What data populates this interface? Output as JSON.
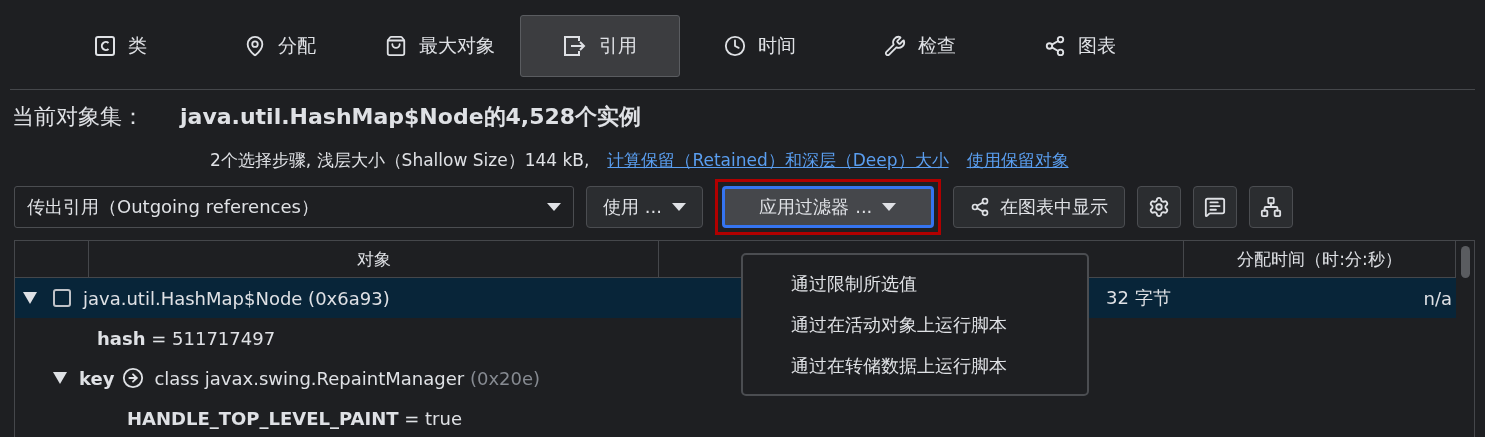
{
  "tabs": [
    {
      "label": "类",
      "selected": false
    },
    {
      "label": "分配",
      "selected": false
    },
    {
      "label": "最大对象",
      "selected": false
    },
    {
      "label": "引用",
      "selected": true
    },
    {
      "label": "时间",
      "selected": false
    },
    {
      "label": "检查",
      "selected": false
    },
    {
      "label": "图表",
      "selected": false
    }
  ],
  "header": {
    "label": "当前对象集：",
    "title": "java.util.HashMap$Node的4,528个实例",
    "summary": "2个选择步骤, 浅层大小（Shallow Size）144 kB,",
    "links": [
      "计算保留（Retained）和深层（Deep）大小",
      "使用保留对象"
    ]
  },
  "toolbar": {
    "view_select": "传出引用（Outgoing references）",
    "use_button": "使用 ...",
    "filter_button": "应用过滤器 ...",
    "graph_button": "在图表中显示",
    "highlighted": true
  },
  "filter_menu": {
    "open": true,
    "items": [
      "通过限制所选值",
      "通过在活动对象上运行脚本",
      "通过在转储数据上运行脚本"
    ]
  },
  "table": {
    "columns": [
      "对象",
      "分配时间（时:分:秒）"
    ],
    "rows": [
      {
        "kind": "object",
        "expanded": true,
        "checked": false,
        "selected": true,
        "text": "java.util.HashMap$Node (0x6a93)",
        "size": "32 字节",
        "time": "n/a",
        "children": [
          {
            "kind": "field",
            "name": "hash",
            "value": "= 511717497",
            "selected": false
          },
          {
            "kind": "ref",
            "expanded": true,
            "name": "key",
            "value": "class javax.swing.RepaintManager",
            "address": "(0x20e)",
            "selected": false,
            "children": [
              {
                "kind": "field",
                "name": "HANDLE_TOP_LEVEL_PAINT",
                "value": "= true",
                "selected": false
              }
            ]
          }
        ]
      }
    ]
  }
}
